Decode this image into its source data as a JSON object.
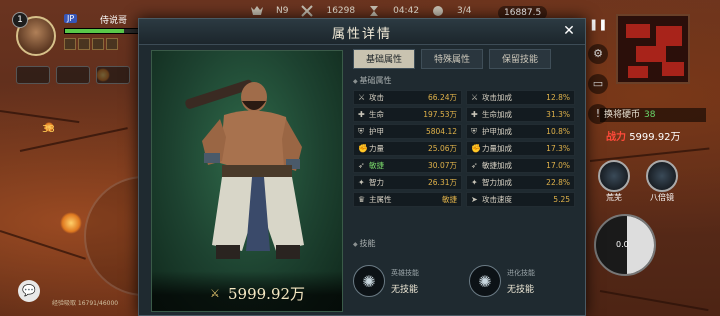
{
  "hud": {
    "player_level": "1",
    "player_tag": "JP",
    "player_name": "侍说哥",
    "hp_percent": 72,
    "map_level": "N9",
    "score": "16298",
    "timer": "04:42",
    "wave": "3/4",
    "coins": "16887.5",
    "kill_count": "38",
    "exp_text": "经验吸取 16791/46000",
    "switch_hand_label": "换将硬币",
    "switch_hand_count": "38",
    "power_label": "战力",
    "power_value": "5999.92万",
    "skill_1_label": "荒芜",
    "skill_2_label": "八倍镜",
    "joystick_value": "0.0",
    "zone_label": "攥头"
  },
  "modal": {
    "title": "属性详情",
    "close_icon": "close-icon",
    "tabs": [
      {
        "label": "基础属性",
        "active": true
      },
      {
        "label": "特殊属性",
        "active": false
      },
      {
        "label": "保留技能",
        "active": false
      }
    ],
    "base_section_label": "基础属性",
    "stats": [
      {
        "left": {
          "icon": "sword-icon",
          "name": "攻击",
          "value": "66.24万"
        },
        "right": {
          "icon": "sword-plus-icon",
          "name": "攻击加成",
          "value": "12.8%"
        }
      },
      {
        "left": {
          "icon": "cross-icon",
          "name": "生命",
          "value": "197.53万"
        },
        "right": {
          "icon": "cross-plus-icon",
          "name": "生命加成",
          "value": "31.3%"
        }
      },
      {
        "left": {
          "icon": "shield-icon",
          "name": "护甲",
          "value": "5804.12"
        },
        "right": {
          "icon": "shield-plus-icon",
          "name": "护甲加成",
          "value": "10.8%"
        }
      },
      {
        "left": {
          "icon": "fist-icon",
          "name": "力量",
          "value": "25.06万"
        },
        "right": {
          "icon": "fist-plus-icon",
          "name": "力量加成",
          "value": "17.3%"
        }
      },
      {
        "left": {
          "icon": "agility-icon",
          "name": "敏捷",
          "value": "30.07万",
          "highlight": true
        },
        "right": {
          "icon": "agility-plus-icon",
          "name": "敏捷加成",
          "value": "17.0%"
        }
      },
      {
        "left": {
          "icon": "brain-icon",
          "name": "智力",
          "value": "26.31万"
        },
        "right": {
          "icon": "brain-plus-icon",
          "name": "智力加成",
          "value": "22.8%"
        }
      },
      {
        "left": {
          "icon": "main-attr-icon",
          "name": "主属性",
          "value": "敏捷"
        },
        "right": {
          "icon": "speed-icon",
          "name": "攻击速度",
          "value": "5.25"
        }
      }
    ],
    "skill_section_label": "技能",
    "skills": [
      {
        "category": "英雄技能",
        "value": "无技能"
      },
      {
        "category": "进化技能",
        "value": "无技能"
      }
    ],
    "power_value": "5999.92万"
  }
}
